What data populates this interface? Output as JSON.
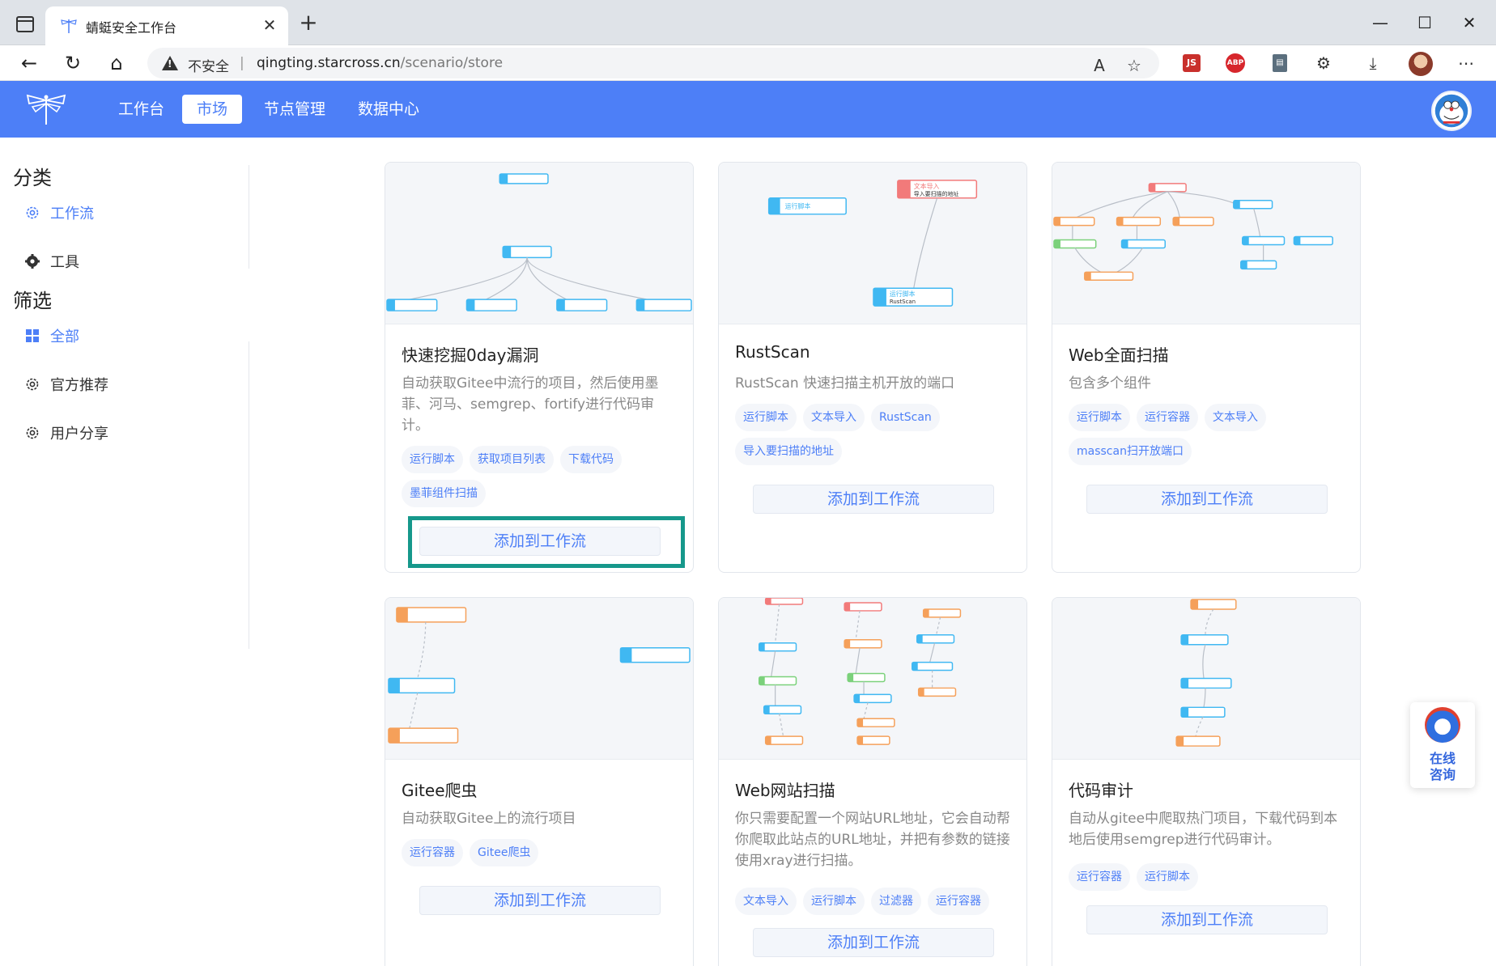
{
  "browser": {
    "tab_title": "蜻蜓安全工作台",
    "insecure_label": "不安全",
    "url_host": "qingting.starcross.cn",
    "url_path": "/scenario/store",
    "ext_js": "JS",
    "ext_abp": "ABP"
  },
  "header": {
    "nav": [
      "工作台",
      "市场",
      "节点管理",
      "数据中心"
    ],
    "active_nav": "市场"
  },
  "sidebar": {
    "category_heading": "分类",
    "categories": [
      "工作流",
      "工具"
    ],
    "filter_heading": "筛选",
    "filters": [
      "全部",
      "官方推荐",
      "用户分享"
    ]
  },
  "cards": [
    {
      "title": "快速挖掘0day漏洞",
      "desc": "自动获取Gitee中流行的项目，然后使用墨菲、河马、semgrep、fortify进行代码审计。",
      "tags": [
        "运行脚本",
        "获取项目列表",
        "下载代码",
        "墨菲组件扫描"
      ],
      "button": "添加到工作流"
    },
    {
      "title": "RustScan",
      "desc": "RustScan 快速扫描主机开放的端口",
      "tags": [
        "运行脚本",
        "文本导入",
        "RustScan",
        "导入要扫描的地址"
      ],
      "button": "添加到工作流"
    },
    {
      "title": "Web全面扫描",
      "desc": "包含多个组件",
      "tags": [
        "运行脚本",
        "运行容器",
        "文本导入",
        "masscan扫开放端口"
      ],
      "button": "添加到工作流"
    },
    {
      "title": "Gitee爬虫",
      "desc": "自动获取Gitee上的流行项目",
      "tags": [
        "运行容器",
        "Gitee爬虫"
      ],
      "button": "添加到工作流"
    },
    {
      "title": "Web网站扫描",
      "desc": "你只需要配置一个网站URL地址，它会自动帮你爬取此站点的URL地址，并把有参数的链接使用xray进行扫描。",
      "tags": [
        "文本导入",
        "运行脚本",
        "过滤器",
        "运行容器"
      ],
      "button": "添加到工作流"
    },
    {
      "title": "代码审计",
      "desc": "自动从gitee中爬取热门项目，下载代码到本地后使用semgrep进行代码审计。",
      "tags": [
        "运行容器",
        "运行脚本"
      ],
      "button": "添加到工作流"
    }
  ],
  "preview_labels": {
    "run_script": "运行脚本",
    "text_import": "文本导入",
    "import_addr": "导入要扫描的地址",
    "rustscan": "RustScan"
  },
  "consult": {
    "line1": "在线",
    "line2": "咨询"
  },
  "colors": {
    "brand": "#4d7ff7",
    "highlight": "#16988b"
  }
}
